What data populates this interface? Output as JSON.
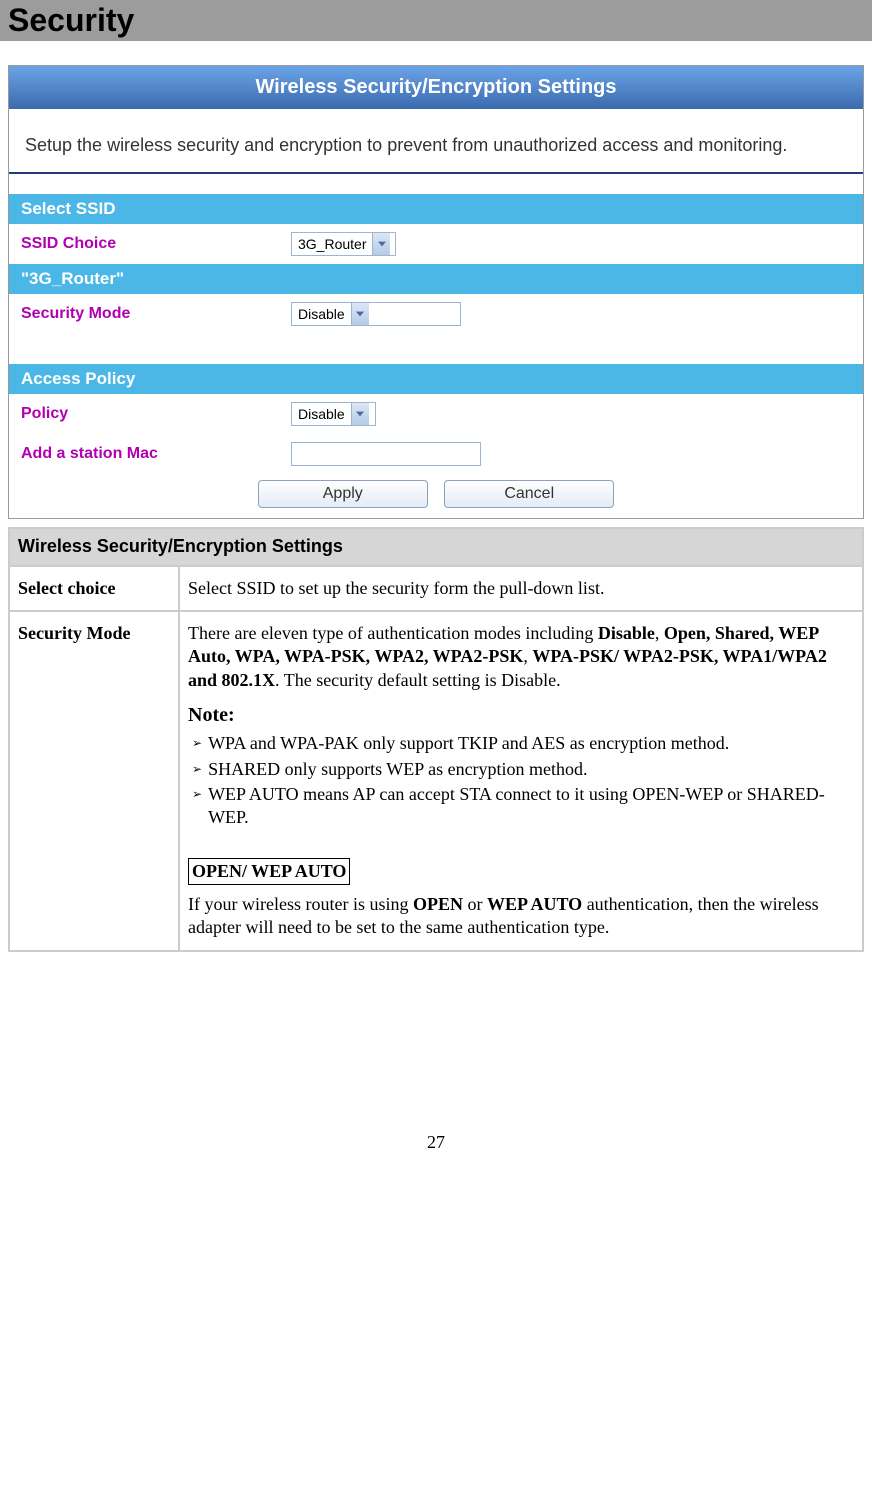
{
  "page_heading": "Security",
  "router_ui": {
    "title": "Wireless Security/Encryption Settings",
    "intro": "Setup the wireless security and encryption to prevent from unauthorized access and monitoring.",
    "sections": {
      "select_ssid": {
        "band": "Select SSID",
        "ssid_choice_label": "SSID Choice",
        "ssid_choice_value": "3G_Router",
        "current_ssid_band": "\"3G_Router\"",
        "security_mode_label": "Security Mode",
        "security_mode_value": "Disable"
      },
      "access_policy": {
        "band": "Access Policy",
        "policy_label": "Policy",
        "policy_value": "Disable",
        "add_mac_label": "Add a station Mac",
        "add_mac_value": ""
      }
    },
    "buttons": {
      "apply": "Apply",
      "cancel": "Cancel"
    }
  },
  "desc": {
    "table_title": "Wireless Security/Encryption Settings",
    "rows": {
      "select_choice": {
        "label": "Select choice",
        "text": "Select SSID to set up the security form the pull-down list."
      },
      "security_mode": {
        "label": "Security Mode",
        "para1_intro": "There are eleven type of authentication modes including ",
        "para1_bold1": "Disable",
        "para1_comma": ", ",
        "para1_bold2": "Open, Shared, WEP Auto, WPA, WPA-PSK, WPA2, WPA2-PSK",
        "para1_comma2": ", ",
        "para1_bold3": "WPA-PSK/ WPA2-PSK, WPA1/WPA2 and 802.1X",
        "para1_tail": ". The security default setting is Disable.",
        "note_heading": "Note:",
        "bullets": [
          "WPA and WPA-PAK only support TKIP and AES as encryption method.",
          "SHARED only supports WEP as encryption method.",
          "WEP AUTO means AP can accept STA connect to it using OPEN-WEP or SHARED-WEP."
        ],
        "boxed": "OPEN/ WEP AUTO",
        "para2_intro": "If your wireless router is using ",
        "para2_bold1": "OPEN",
        "para2_mid": " or ",
        "para2_bold2": "WEP AUTO",
        "para2_tail": " authentication, then the wireless adapter will need to be set to the same authentication type."
      }
    }
  },
  "page_number": "27"
}
